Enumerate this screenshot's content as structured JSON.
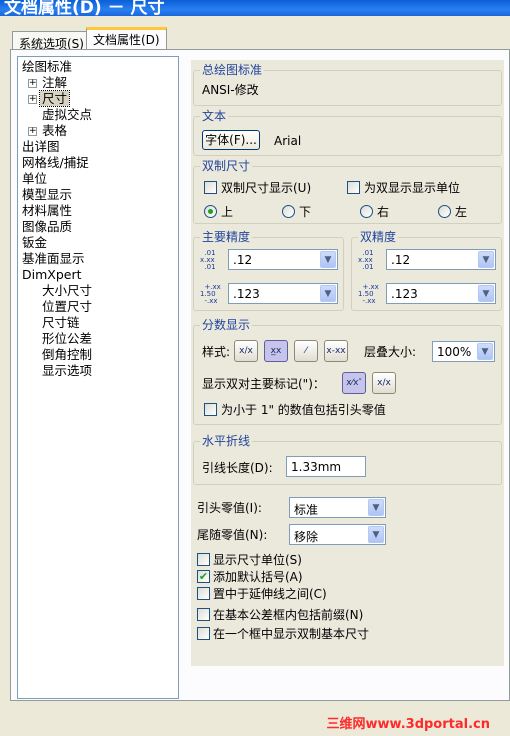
{
  "window": {
    "title": "文档属性(D) － 尺寸"
  },
  "tabs": [
    {
      "label": "系统选项(S)"
    },
    {
      "label": "文档属性(D)"
    }
  ],
  "tree": {
    "items": [
      {
        "label": "绘图标准"
      },
      {
        "label": "注解"
      },
      {
        "label": "尺寸"
      },
      {
        "label": "虚拟交点"
      },
      {
        "label": "表格"
      },
      {
        "label": "出详图"
      },
      {
        "label": "网格线/捕捉"
      },
      {
        "label": "单位"
      },
      {
        "label": "模型显示"
      },
      {
        "label": "材料属性"
      },
      {
        "label": "图像品质"
      },
      {
        "label": "钣金"
      },
      {
        "label": "基准面显示"
      },
      {
        "label": "DimXpert"
      },
      {
        "label": "大小尺寸"
      },
      {
        "label": "位置尺寸"
      },
      {
        "label": "尺寸链"
      },
      {
        "label": "形位公差"
      },
      {
        "label": "倒角控制"
      },
      {
        "label": "显示选项"
      }
    ]
  },
  "overall_standard": {
    "title": "总绘图标准",
    "value": "ANSI-修改"
  },
  "text_group": {
    "title": "文本",
    "font_button": "字体(F)...",
    "font_name": "Arial"
  },
  "dual_dim": {
    "title": "双制尺寸",
    "show_dual_label": "双制尺寸显示(U)",
    "show_units_label": "为双显示显示单位",
    "radio_top": "上",
    "radio_bottom": "下",
    "radio_right": "右",
    "radio_left": "左"
  },
  "primary_precision": {
    "title": "主要精度",
    "value1": ".12",
    "value2": ".123"
  },
  "dual_precision": {
    "title": "双精度",
    "value1": ".12",
    "value2": ".123"
  },
  "fraction": {
    "title": "分数显示",
    "style_label": "样式:",
    "stack_label": "层叠大小:",
    "stack_value": "100%",
    "show_dual_label": "显示双对主要标记(\")：",
    "include_zero_label": "为小于 1\" 的数值包括引头零值"
  },
  "horizontal_break": {
    "title": "水平折线",
    "leader_label": "引线长度(D):",
    "leader_value": "1.33mm"
  },
  "zeros": {
    "leading_label": "引头零值(I):",
    "leading_value": "标准",
    "trailing_label": "尾随零值(N):",
    "trailing_value": "移除"
  },
  "options": [
    {
      "label": "显示尺寸单位(S)",
      "checked": false
    },
    {
      "label": "添加默认括号(A)",
      "checked": true
    },
    {
      "label": "置中于延伸线之间(C)",
      "checked": false
    },
    {
      "label": "在基本公差框内包括前缀(N)",
      "checked": false
    },
    {
      "label": "在一个框中显示双制基本尺寸",
      "checked": false
    }
  ],
  "watermark": "三维网www.3dportal.cn"
}
